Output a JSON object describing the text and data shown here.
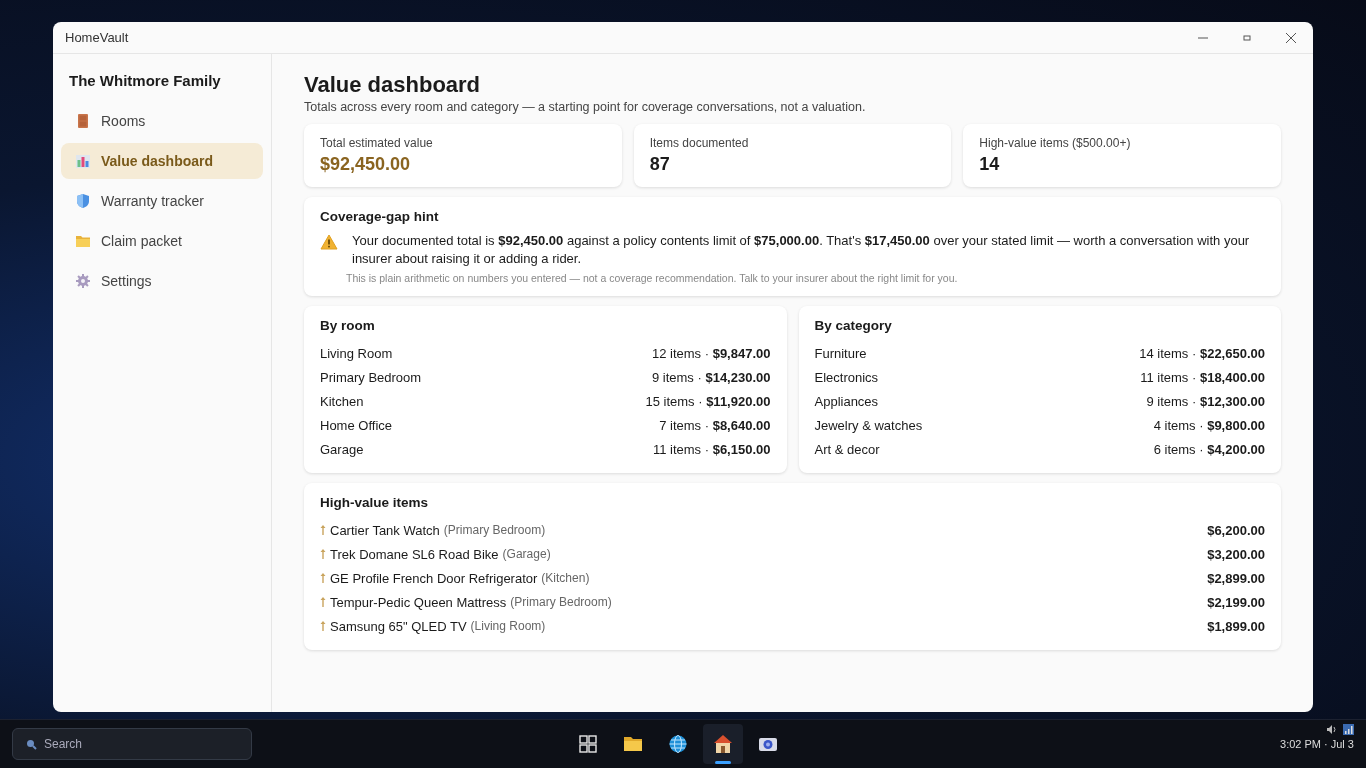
{
  "window": {
    "title": "HomeVault"
  },
  "sidebar": {
    "title": "The Whitmore Family",
    "items": [
      {
        "label": "Rooms",
        "selected": false
      },
      {
        "label": "Value dashboard",
        "selected": true
      },
      {
        "label": "Warranty tracker",
        "selected": false
      },
      {
        "label": "Claim packet",
        "selected": false
      },
      {
        "label": "Settings",
        "selected": false
      }
    ]
  },
  "page": {
    "title": "Value dashboard",
    "subtitle": "Totals across every room and category — a starting point for coverage conversations, not a valuation."
  },
  "stats": [
    {
      "label": "Total estimated value",
      "value": "$92,450.00",
      "accent": true
    },
    {
      "label": "Items documented",
      "value": "87",
      "accent": false
    },
    {
      "label": "High-value items ($500.00+)",
      "value": "14",
      "accent": false
    }
  ],
  "hint": {
    "title": "Coverage-gap hint",
    "text": "Your documented total is **$92,450.00** against a policy contents limit of **$75,000.00**. That's **$17,450.00** over your stated limit — worth a conversation with your insurer about raising it or adding a rider.",
    "note": "This is plain arithmetic on numbers you entered — not a coverage recommendation. Talk to your insurer about the right limit for you."
  },
  "by_room": {
    "title": "By room",
    "rows": [
      {
        "name": "Living Room",
        "summary": "12 items · **$9,847.00**"
      },
      {
        "name": "Primary Bedroom",
        "summary": "9 items · **$14,230.00**"
      },
      {
        "name": "Kitchen",
        "summary": "15 items · **$11,920.00**"
      },
      {
        "name": "Home Office",
        "summary": "7 items · **$8,640.00**"
      },
      {
        "name": "Garage",
        "summary": "11 items · **$6,150.00**"
      }
    ]
  },
  "by_category": {
    "title": "By category",
    "rows": [
      {
        "name": "Furniture",
        "summary": "14 items · **$22,650.00**"
      },
      {
        "name": "Electronics",
        "summary": "11 items · **$18,400.00**"
      },
      {
        "name": "Appliances",
        "summary": "9 items · **$12,300.00**"
      },
      {
        "name": "Jewelry & watches",
        "summary": "4 items · **$9,800.00**"
      },
      {
        "name": "Art & decor",
        "summary": "6 items · **$4,200.00**"
      }
    ]
  },
  "high_value": {
    "title": "High-value items",
    "rows": [
      {
        "name": "Cartier Tank Watch",
        "room": "(Primary Bedroom)",
        "value": "$6,200.00"
      },
      {
        "name": "Trek Domane SL6 Road Bike",
        "room": "(Garage)",
        "value": "$3,200.00"
      },
      {
        "name": "GE Profile French Door Refrigerator",
        "room": "(Kitchen)",
        "value": "$2,899.00"
      },
      {
        "name": "Tempur-Pedic Queen Mattress",
        "room": "(Primary Bedroom)",
        "value": "$2,199.00"
      },
      {
        "name": "Samsung 65\" QLED TV",
        "room": "(Living Room)",
        "value": "$1,899.00"
      }
    ]
  },
  "taskbar": {
    "search_placeholder": "Search",
    "apps": [
      {
        "selected": false
      },
      {
        "selected": false
      },
      {
        "selected": false
      },
      {
        "selected": true
      },
      {
        "selected": false
      }
    ],
    "clock": "3:02 PM · Jul 3"
  }
}
